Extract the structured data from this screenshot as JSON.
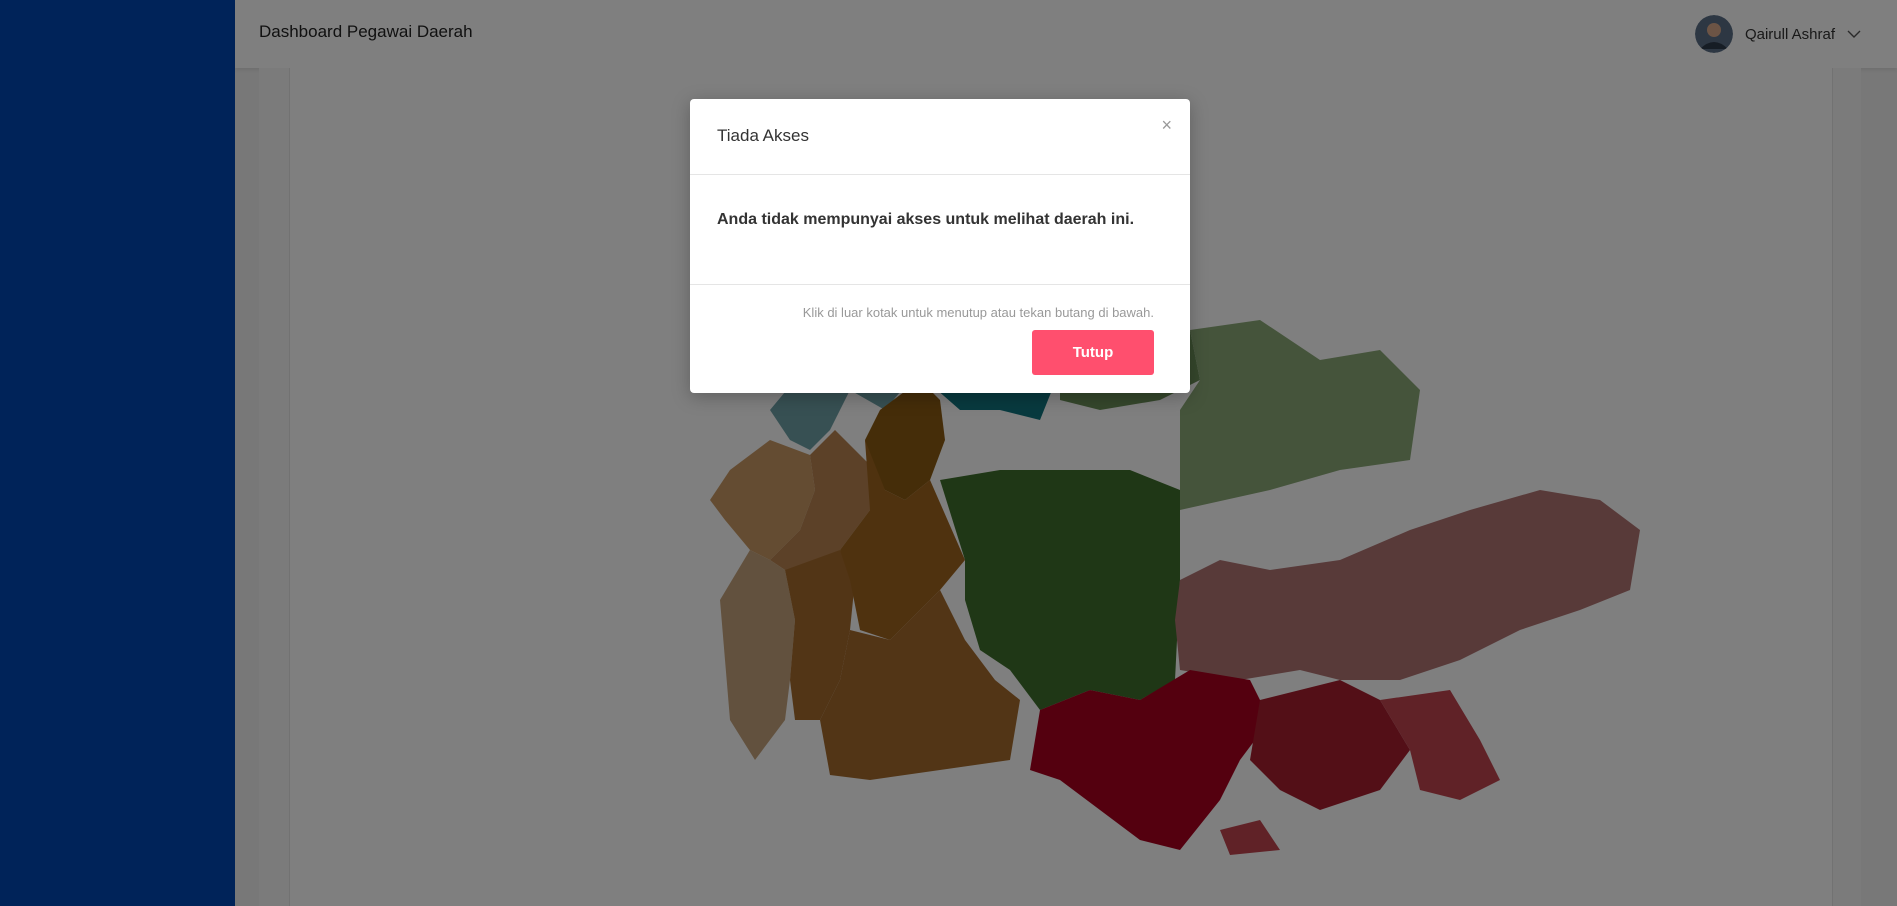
{
  "header": {
    "title": "Dashboard Pegawai Daerah"
  },
  "user": {
    "name": "Qairull Ashraf",
    "avatar_icon": "user-avatar-photo",
    "menu_icon": "chevron-down-icon"
  },
  "modal": {
    "title": "Tiada Akses",
    "message": "Anda tidak mempunyai akses untuk melihat daerah ini.",
    "hint": "Klik di luar kotak untuk menutup atau tekan butang di bawah.",
    "close_label": "Tutup",
    "close_icon": "×"
  },
  "colors": {
    "sidebar": "#0047b3",
    "button": "#ff4f6e"
  }
}
